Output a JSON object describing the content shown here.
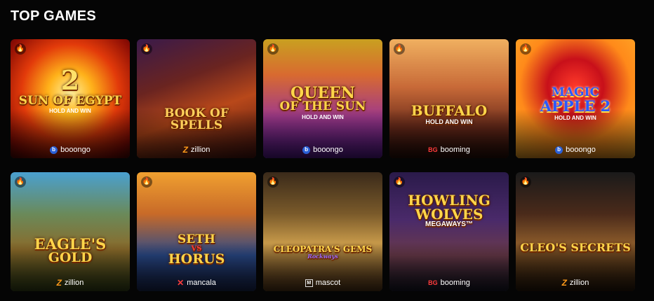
{
  "section": {
    "title": "TOP GAMES"
  },
  "hot_icon": "🔥",
  "games": [
    {
      "name_line1": "2",
      "name_line2": "SUN OF EGYPT",
      "name_line3": "HOLD AND WIN",
      "provider": "booongo",
      "provider_icon": "b"
    },
    {
      "name_line1": "",
      "name_line2": "BOOK OF SPELLS",
      "name_line3": "",
      "provider": "zillion",
      "provider_icon": "Z"
    },
    {
      "name_line1": "QUEEN",
      "name_line2": "OF THE SUN",
      "name_line3": "HOLD AND WIN",
      "provider": "booongo",
      "provider_icon": "b"
    },
    {
      "name_line1": "",
      "name_line2": "BUFFALO",
      "name_line3": "HOLD AND WIN",
      "provider": "booming",
      "provider_icon": "BG"
    },
    {
      "name_line1": "MAGIC",
      "name_line2": "APPLE 2",
      "name_line3": "HOLD AND WIN",
      "provider": "booongo",
      "provider_icon": "b"
    },
    {
      "name_line1": "",
      "name_line2": "EAGLE'S",
      "name_line3": "GOLD",
      "provider": "zillion",
      "provider_icon": "Z"
    },
    {
      "name_line1": "SETH",
      "name_line2": "VS",
      "name_line3": "HORUS",
      "provider": "mancala",
      "provider_icon": "✕"
    },
    {
      "name_line1": "",
      "name_line2": "CLEOPATRA'S GEMS",
      "name_line3": "Rockways",
      "provider": "mascot",
      "provider_icon": "M"
    },
    {
      "name_line1": "HOWLING",
      "name_line2": "WOLVES",
      "name_line3": "MEGAWAYS™",
      "provider": "booming",
      "provider_icon": "BG"
    },
    {
      "name_line1": "",
      "name_line2": "CLEO'S SECRETS",
      "name_line3": "",
      "provider": "zillion",
      "provider_icon": "Z"
    }
  ]
}
